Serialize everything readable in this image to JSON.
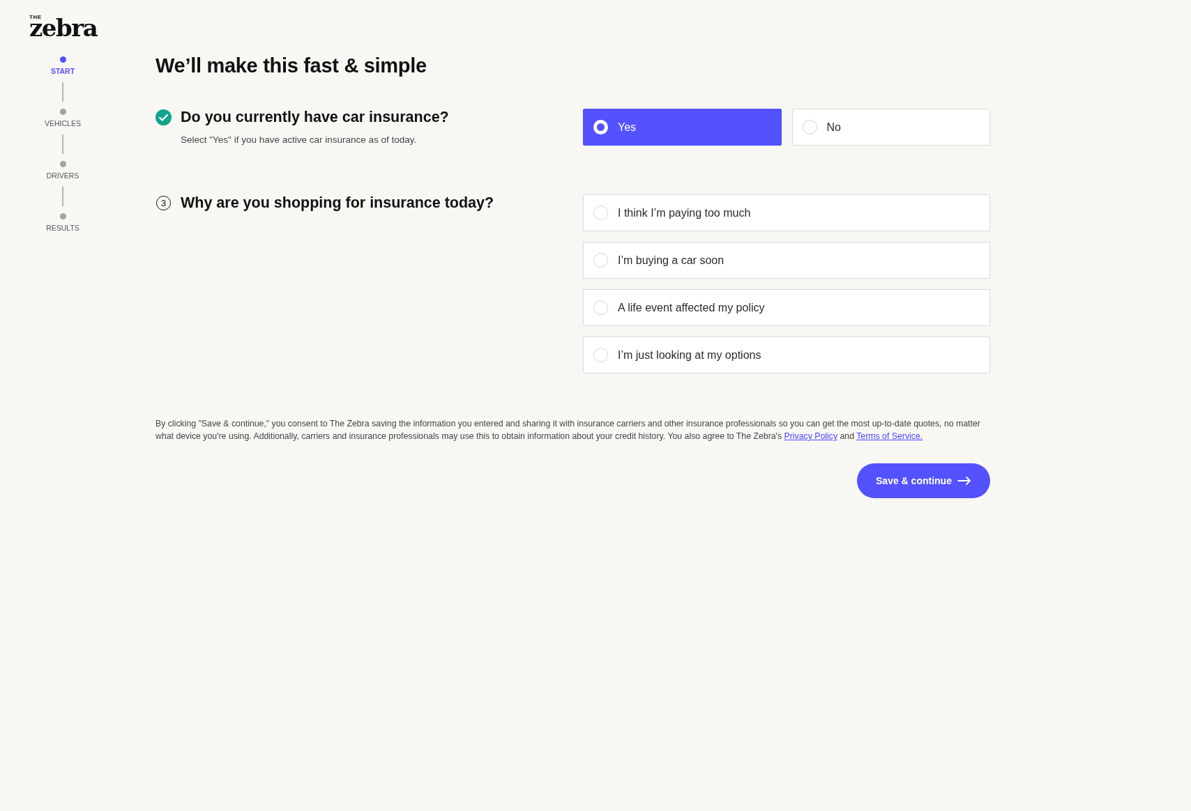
{
  "logo": {
    "small": "THE",
    "large": "zebra"
  },
  "steps": [
    {
      "label": "START",
      "selected": true
    },
    {
      "label": "VEHICLES",
      "selected": false
    },
    {
      "label": "DRIVERS",
      "selected": false
    },
    {
      "label": "RESULTS",
      "selected": false
    }
  ],
  "title": "We’ll make this fast & simple",
  "questions": [
    {
      "kind": "answered",
      "question": "Do you currently have car insurance?",
      "hint": "Select \"Yes\" if you have active car insurance as of today.",
      "inline": true,
      "options": [
        {
          "label": "Yes",
          "selected": true
        },
        {
          "label": "No",
          "selected": false
        }
      ]
    },
    {
      "kind": "numbered",
      "number": "3",
      "question": "Why are you shopping for insurance today?",
      "inline": false,
      "options": [
        {
          "label": "I think I’m paying too much",
          "selected": false
        },
        {
          "label": "I’m buying a car soon",
          "selected": false
        },
        {
          "label": "A life event affected my policy",
          "selected": false
        },
        {
          "label": "I’m just looking at my options",
          "selected": false
        }
      ]
    }
  ],
  "disclaimer": {
    "text": "By clicking \"Save & continue,\" you consent to The Zebra saving the information you entered and sharing it with insurance carriers and other insurance professionals so you can get the most up-to-date quotes, no matter what device you're using. Additionally, carriers and insurance professionals may use this to obtain information about your credit history. You also agree to The Zebra's",
    "links": [
      "Privacy Policy",
      "Terms of Service."
    ],
    "joiner": "and"
  },
  "submit": "Save & continue"
}
